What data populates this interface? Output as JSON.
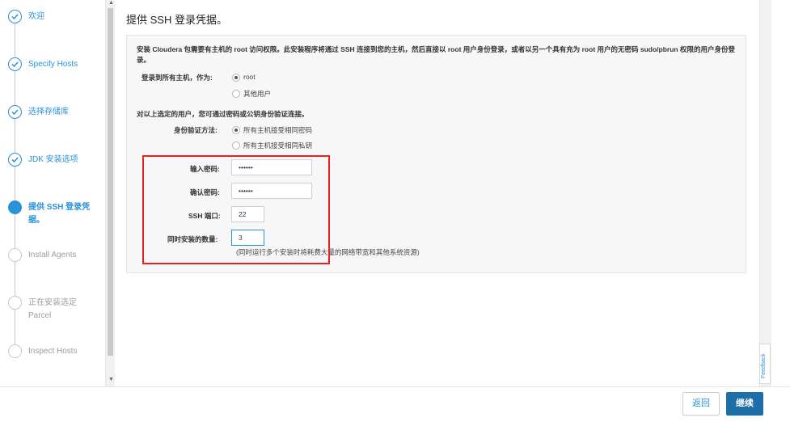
{
  "steps": [
    {
      "label": "欢迎",
      "state": "done"
    },
    {
      "label": "Specify Hosts",
      "state": "done"
    },
    {
      "label": "选择存储库",
      "state": "done"
    },
    {
      "label": "JDK 安装选项",
      "state": "done"
    },
    {
      "label": "提供 SSH 登录凭据。",
      "state": "current"
    },
    {
      "label": "Install Agents",
      "state": "pending"
    },
    {
      "label": "正在安装选定 Parcel",
      "state": "pending"
    },
    {
      "label": "Inspect Hosts",
      "state": "pending"
    }
  ],
  "page": {
    "title": "提供 SSH 登录凭据。",
    "intro": "安装 Cloudera 包需要有主机的 root 访问权限。此安装程序将通过 SSH 连接到您的主机，然后直接以 root 用户身份登录，或者以另一个具有充为 root 用户的无密码 sudo/pbrun 权限的用户身份登录。",
    "login_as_label": "登录到所有主机，作为:",
    "login_options": [
      "root",
      "其他用户"
    ],
    "auth_intro": "对以上选定的用户，您可通过密码或公钥身份验证连接。",
    "auth_method_label": "身份验证方法:",
    "auth_options": [
      "所有主机接受相同密码",
      "所有主机接受相同私钥"
    ],
    "password_label": "输入密码:",
    "password_value": "••••••",
    "confirm_label": "确认密码:",
    "confirm_value": "••••••",
    "ssh_port_label": "SSH 端口:",
    "ssh_port_value": "22",
    "concurrent_label": "同时安装的数量:",
    "concurrent_value": "3",
    "concurrent_hint": "(同时运行多个安装时将耗费大量的网络带宽和其他系统资源)"
  },
  "feedback_label": "Feedback",
  "footer": {
    "back_label": "返回",
    "next_label": "继续"
  },
  "colors": {
    "accent": "#2a92d6",
    "primary_button": "#1e6fa8",
    "highlight": "#e52222"
  }
}
